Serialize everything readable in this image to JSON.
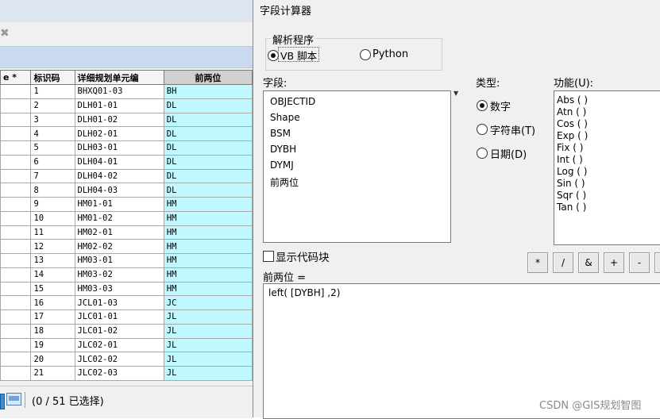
{
  "attribute_table": {
    "columns": [
      "e *",
      "标识码",
      "详细规划单元编",
      "前两位"
    ],
    "rows": [
      [
        "",
        "1",
        "BHXQ01-03",
        "BH"
      ],
      [
        "",
        "2",
        "DLH01-01",
        "DL"
      ],
      [
        "",
        "3",
        "DLH01-02",
        "DL"
      ],
      [
        "",
        "4",
        "DLH02-01",
        "DL"
      ],
      [
        "",
        "5",
        "DLH03-01",
        "DL"
      ],
      [
        "",
        "6",
        "DLH04-01",
        "DL"
      ],
      [
        "",
        "7",
        "DLH04-02",
        "DL"
      ],
      [
        "",
        "8",
        "DLH04-03",
        "DL"
      ],
      [
        "",
        "9",
        "HM01-01",
        "HM"
      ],
      [
        "",
        "10",
        "HM01-02",
        "HM"
      ],
      [
        "",
        "11",
        "HM02-01",
        "HM"
      ],
      [
        "",
        "12",
        "HM02-02",
        "HM"
      ],
      [
        "",
        "13",
        "HM03-01",
        "HM"
      ],
      [
        "",
        "14",
        "HM03-02",
        "HM"
      ],
      [
        "",
        "15",
        "HM03-03",
        "HM"
      ],
      [
        "",
        "16",
        "JCL01-03",
        "JC"
      ],
      [
        "",
        "17",
        "JLC01-01",
        "JL"
      ],
      [
        "",
        "18",
        "JLC01-02",
        "JL"
      ],
      [
        "",
        "19",
        "JLC02-01",
        "JL"
      ],
      [
        "",
        "20",
        "JLC02-02",
        "JL"
      ],
      [
        "",
        "21",
        "JLC02-03",
        "JL"
      ]
    ],
    "status": "(0 / 51 已选择)",
    "close_glyph": "✖"
  },
  "dialog": {
    "title": "字段计算器",
    "parser_legend": "解析程序",
    "parser_options": [
      "VB 脚本",
      "Python"
    ],
    "fields_label": "字段:",
    "fields": [
      "OBJECTID",
      "Shape",
      "BSM",
      "DYBH",
      "DYMJ",
      "前两位"
    ],
    "type_label": "类型:",
    "types": [
      "数字",
      "字符串(T)",
      "日期(D)"
    ],
    "functions_label": "功能(U):",
    "functions": [
      "Abs ( )",
      "Atn ( )",
      "Cos ( )",
      "Exp ( )",
      "Fix ( )",
      "Int ( )",
      "Log ( )",
      "Sin ( )",
      "Sqr ( )",
      "Tan ( )"
    ],
    "show_code_label": "显示代码块",
    "operators": [
      "*",
      "/",
      "&",
      "+",
      "-"
    ],
    "expression_label": "前两位 =",
    "expression": "left( [DYBH] ,2)"
  },
  "watermark": "CSDN @GIS规划智图",
  "colors": {
    "highlight_cell": "#bff9ff",
    "dialog_bg": "#f0f0f0"
  }
}
